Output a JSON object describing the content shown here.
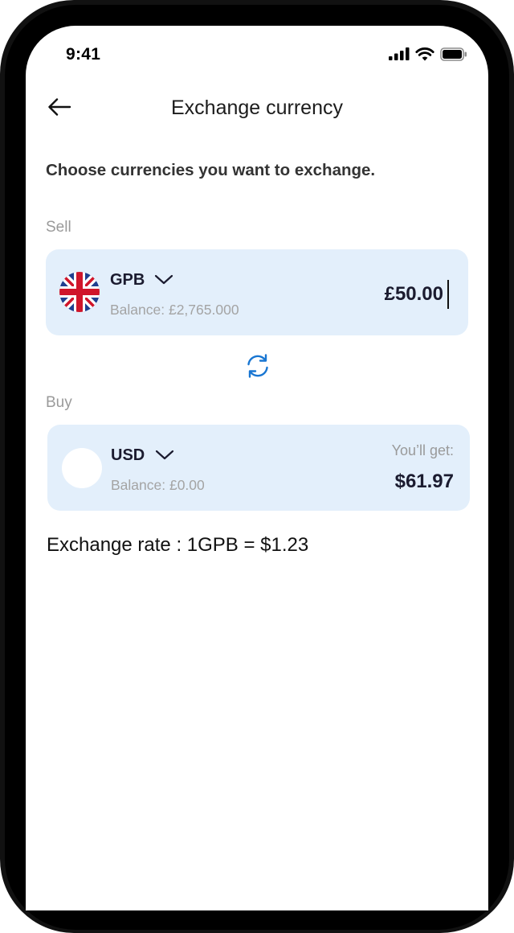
{
  "status_bar": {
    "time": "9:41",
    "icons": [
      "signal-bars-icon",
      "wifi-icon",
      "battery-icon"
    ]
  },
  "header": {
    "back_icon": "arrow-left-icon",
    "title": "Exchange currency"
  },
  "instruction": "Choose currencies you want to exchange.",
  "sell": {
    "label": "Sell",
    "flag_icon": "uk-flag-icon",
    "currency": "GPB",
    "balance": "Balance: £2,765.000",
    "amount": "£50.00"
  },
  "swap_icon": "swap-arrows-icon",
  "buy": {
    "label": "Buy",
    "flag_icon": "blank-flag-icon",
    "currency": "USD",
    "balance": "Balance: £0.00",
    "get_label": "You’ll get:",
    "get_amount": "$61.97"
  },
  "exchange_rate": "Exchange rate : 1GPB = $1.23",
  "colors": {
    "card_bg": "#e3effb",
    "accent": "#1976d2",
    "flag_blue": "#1f3f8f",
    "flag_red": "#d0152a"
  }
}
